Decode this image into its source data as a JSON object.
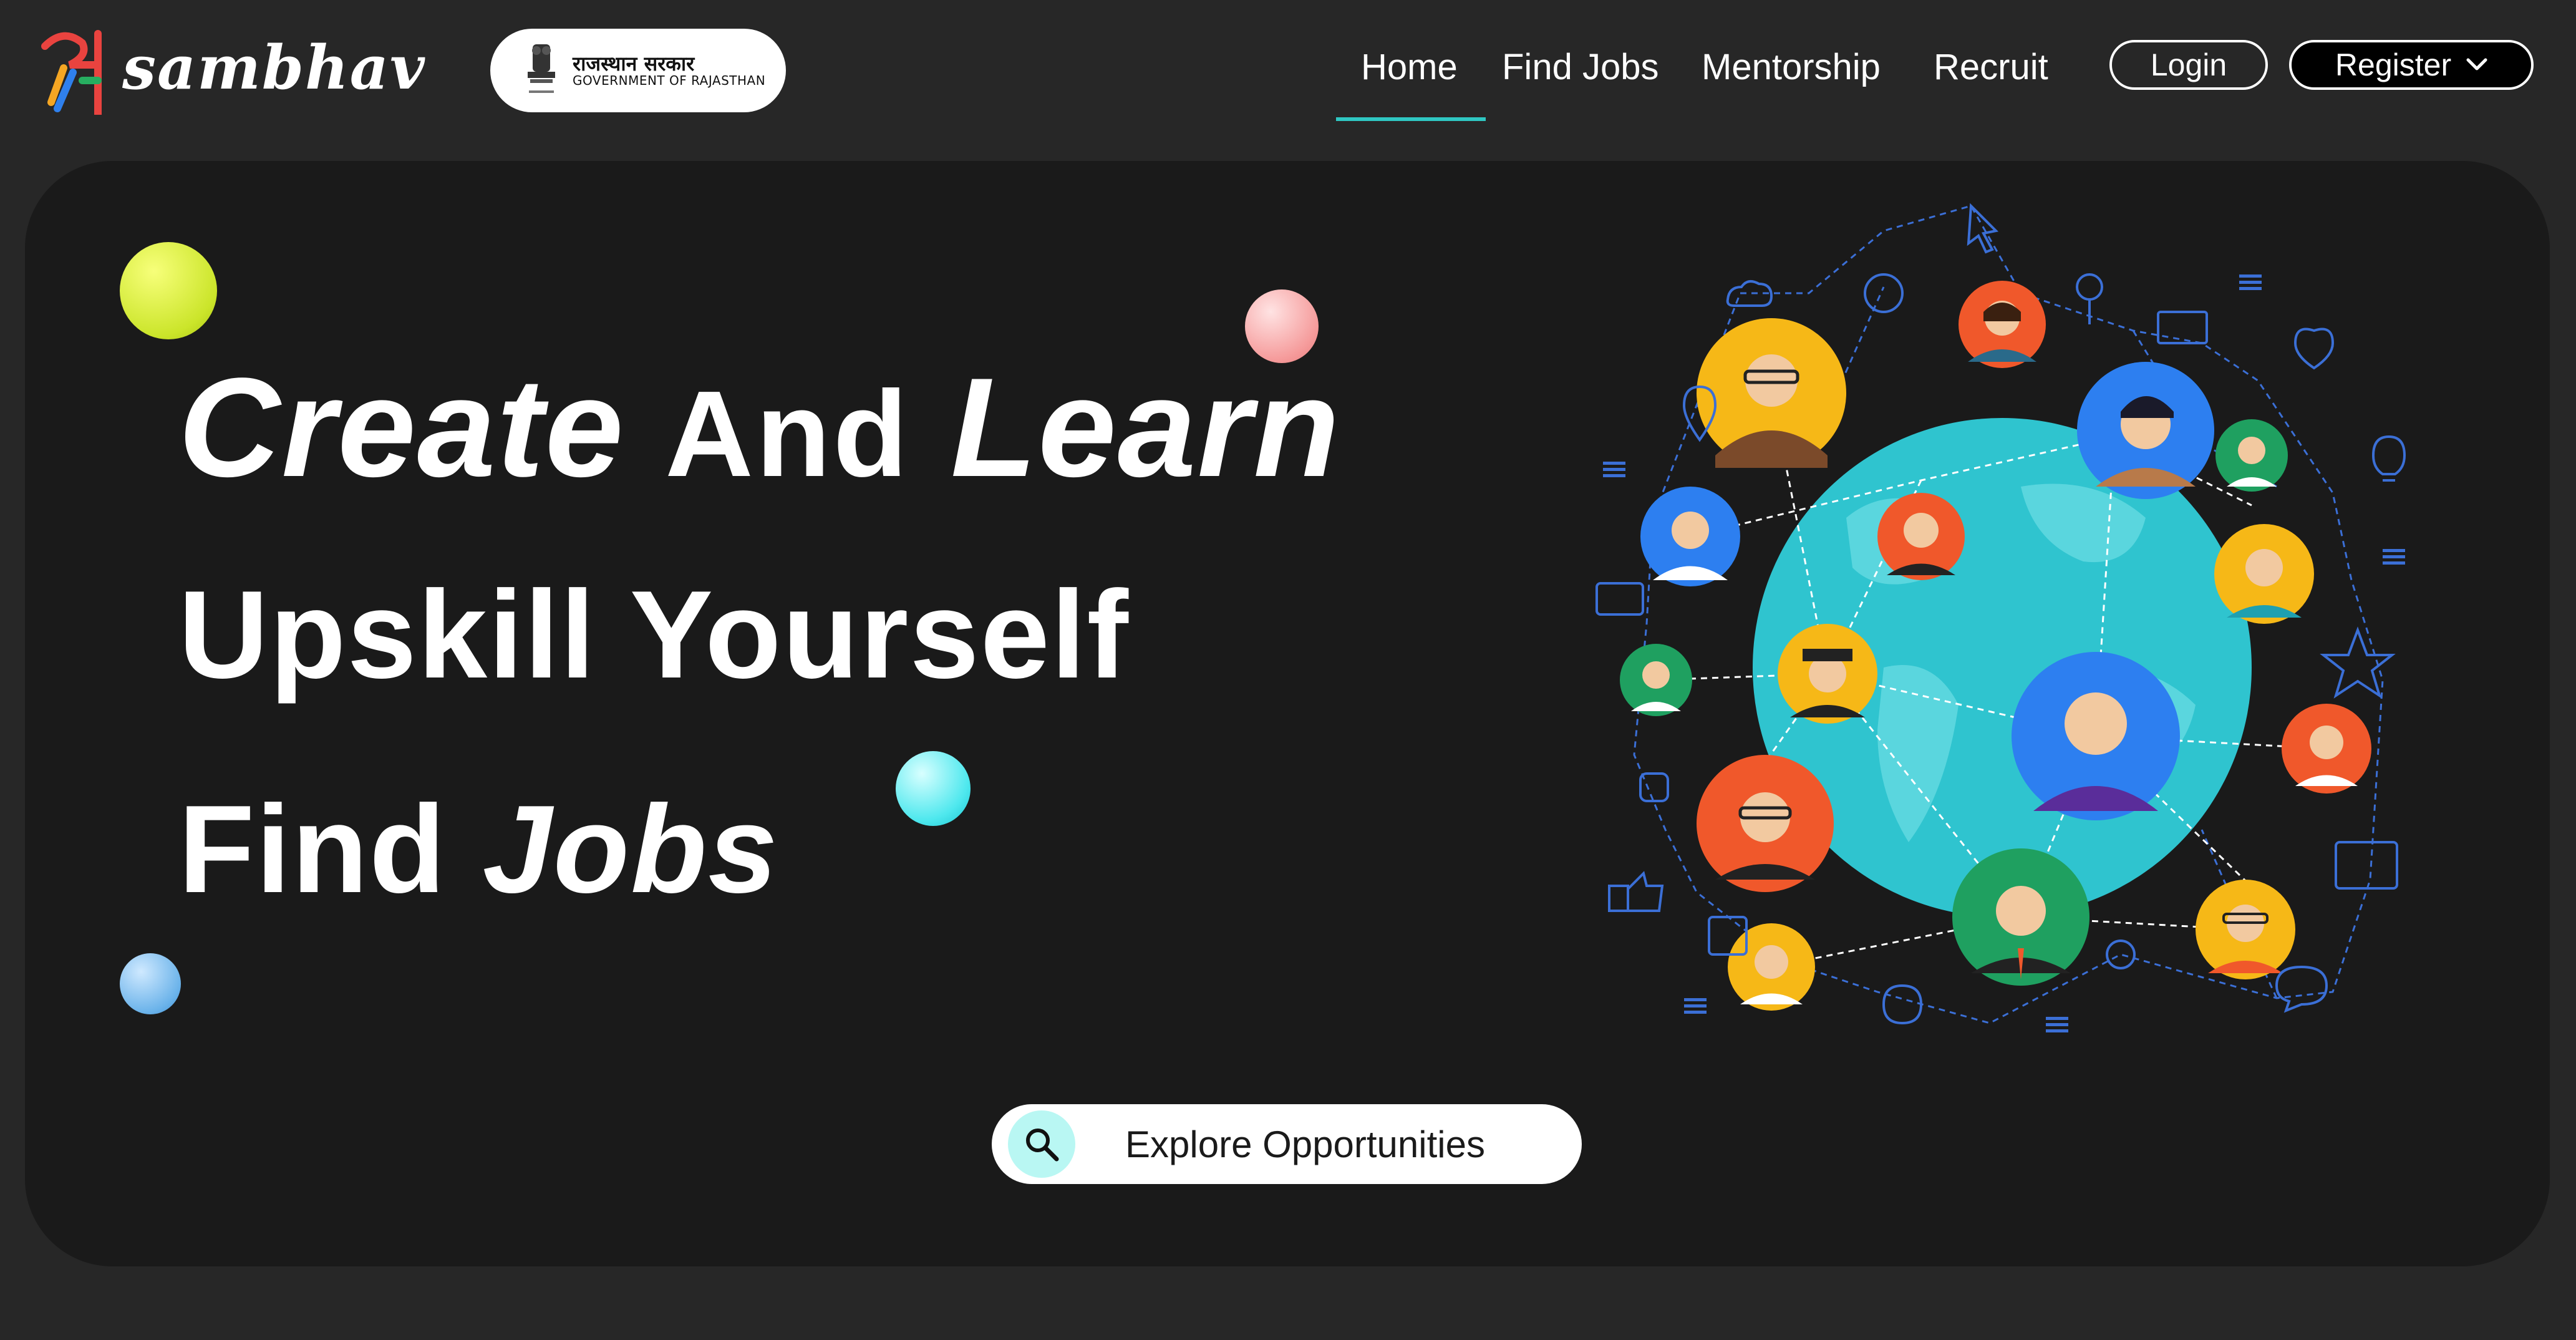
{
  "header": {
    "logo_text": "sambhav",
    "gov_badge": {
      "hindi": "राजस्थान सरकार",
      "english": "GOVERNMENT OF RAJASTHAN"
    },
    "nav": [
      {
        "label": "Home",
        "active": true
      },
      {
        "label": "Find Jobs",
        "active": false
      },
      {
        "label": "Mentorship",
        "active": false
      },
      {
        "label": "Recruit",
        "active": false
      }
    ],
    "login_label": "Login",
    "register_label": "Register"
  },
  "hero": {
    "line1_word1": "Create",
    "line1_word2": "And",
    "line1_word3": "Learn",
    "line2": "Upskill Yourself",
    "line3_word1": "Find",
    "line3_word2": "Jobs",
    "cta_label": "Explore Opportunities"
  },
  "colors": {
    "page_bg": "#272727",
    "card_bg": "#1a1a1a",
    "accent": "#2fc7c2",
    "globe": "#2fc4cf"
  },
  "icons": [
    "search-icon",
    "chevron-down-icon",
    "state-emblem-icon",
    "logo-mark"
  ]
}
